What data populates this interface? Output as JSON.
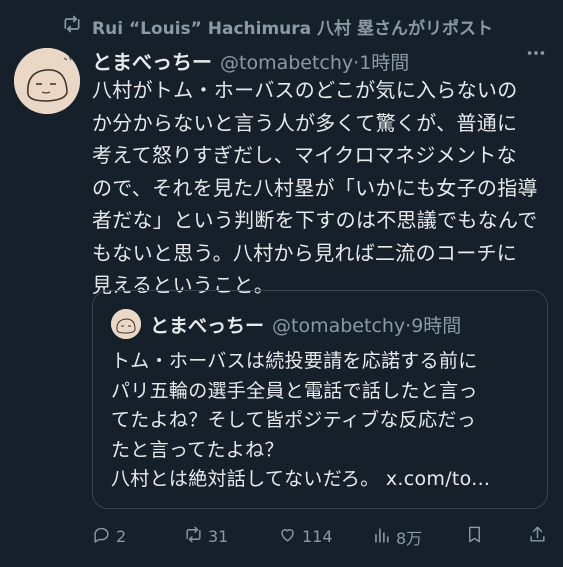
{
  "repost": {
    "text": "Rui “Louis” Hachimura 八村 塁さんがリポスト"
  },
  "tweet": {
    "display_name": "とまべっちー",
    "handle_time": "@tomabetchy·1時間",
    "text": "八村がトム・ホーバスのどこが気に入らないの\nか分からないと言う人が多くて驚くが、普通に\n考えて怒りすぎだし、マイクロマネジメントな\nので、それを見た八村塁が「いかにも女子の指導\n者だな」という判断を下すのは不思議でもなんで\nもないと思う。八村から見れば二流のコーチに\n見えるということ。"
  },
  "quote": {
    "display_name": "とまべっちー",
    "handle_time": "@tomabetchy·9時間",
    "text": "トム・ホーバスは続投要請を応諾する前に\nパリ五輪の選手全員と電話で話したと言っ\nてたよね？そして皆ポジティブな反応だっ\nたと言ってたよね？\n八村とは絶対話してないだろ。",
    "link": "x.com/to..."
  },
  "actions": {
    "replies": "2",
    "reposts": "31",
    "likes": "114",
    "views": "8万"
  },
  "icons": {
    "repost": "repost-icon",
    "more": "more-icon",
    "reply": "reply-icon",
    "like": "heart-icon",
    "views": "views-icon",
    "bookmark": "bookmark-icon",
    "share": "share-icon"
  },
  "colors": {
    "background": "#15202b",
    "text": "#e7e9ea",
    "muted": "#8b98a5",
    "border": "#38444d"
  }
}
